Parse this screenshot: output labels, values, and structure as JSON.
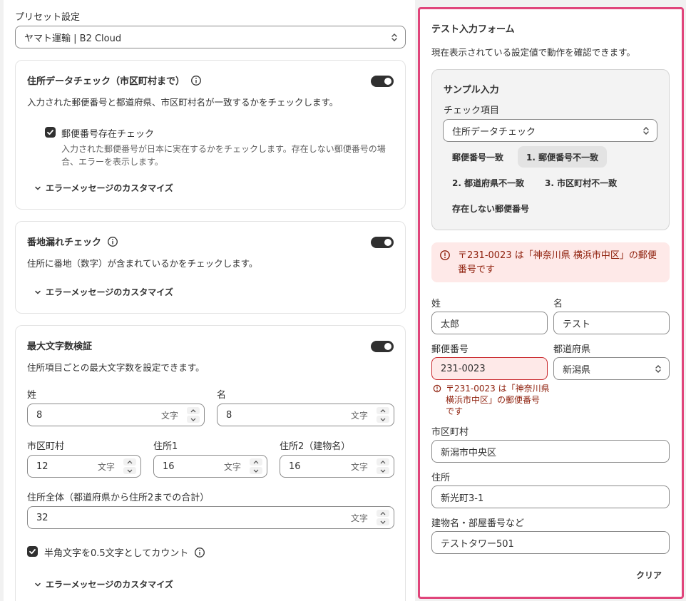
{
  "preset": {
    "label": "プリセット設定",
    "value": "ヤマト運輸 | B2 Cloud"
  },
  "address_check": {
    "title": "住所データチェック（市区町村まで）",
    "description": "入力された郵便番号と都道府県、市区町村名が一致するかをチェックします。",
    "enabled": true,
    "postal_check_label": "郵便番号存在チェック",
    "postal_check_checked": true,
    "postal_check_help_line1": "入力された郵便番号が日本に実在するかをチェックします。存在しない郵便番号の場",
    "postal_check_help_line2": "合、エラーを表示します。",
    "customize_label": "エラーメッセージのカスタマイズ"
  },
  "street_check": {
    "title": "番地漏れチェック",
    "description": "住所に番地（数字）が含まれているかをチェックします。",
    "enabled": true,
    "customize_label": "エラーメッセージのカスタマイズ"
  },
  "max_length": {
    "title": "最大文字数検証",
    "description": "住所項目ごとの最大文字数を設定できます。",
    "enabled": true,
    "unit": "文字",
    "fields": {
      "last_name": {
        "label": "姓",
        "value": "8"
      },
      "first_name": {
        "label": "名",
        "value": "8"
      },
      "city": {
        "label": "市区町村",
        "value": "12"
      },
      "address1": {
        "label": "住所1",
        "value": "16"
      },
      "address2": {
        "label": "住所2（建物名）",
        "value": "16"
      },
      "total": {
        "label": "住所全体（都道府県から住所2までの合計）",
        "value": "32"
      }
    },
    "halfwidth_label": "半角文字を0.5文字としてカウント",
    "halfwidth_checked": true,
    "customize_label": "エラーメッセージのカスタマイズ"
  },
  "test_form": {
    "title": "テスト入力フォーム",
    "description": "現在表示されている設定値で動作を確認できます。",
    "sample": {
      "title": "サンプル入力",
      "check_item_label": "チェック項目",
      "check_item_value": "住所データチェック",
      "chips": [
        "郵便番号一致",
        "1. 郵便番号不一致",
        "2. 都道府県不一致",
        "3. 市区町村不一致",
        "存在しない郵便番号"
      ],
      "active_chip_index": 1
    },
    "banner_error": "〒231-0023 は「神奈川県 横浜市中区」の郵便番号です",
    "banner_error_line1": "〒231-0023 は「神奈川県 横浜市中区」の郵便",
    "banner_error_line2": "番号です",
    "fields": {
      "last_name": {
        "label": "姓",
        "value": "太郎"
      },
      "first_name": {
        "label": "名",
        "value": "テスト"
      },
      "postal": {
        "label": "郵便番号",
        "value": "231-0023"
      },
      "prefecture": {
        "label": "都道府県",
        "value": "新潟県"
      },
      "city": {
        "label": "市区町村",
        "value": "新潟市中央区"
      },
      "address": {
        "label": "住所",
        "value": "新光町3-1"
      },
      "building": {
        "label": "建物名・部屋番号など",
        "value": "テストタワー501"
      }
    },
    "postal_error_line1": "〒231-0023 は「神奈川県",
    "postal_error_line2": "横浜市中区」の郵便番号",
    "postal_error_line3": "です",
    "clear_label": "クリア"
  },
  "colors": {
    "accent_border": "#e0457b",
    "error_bg": "#fee9e8",
    "error_text": "#8e1f0b",
    "toggle_on": "#303030"
  }
}
